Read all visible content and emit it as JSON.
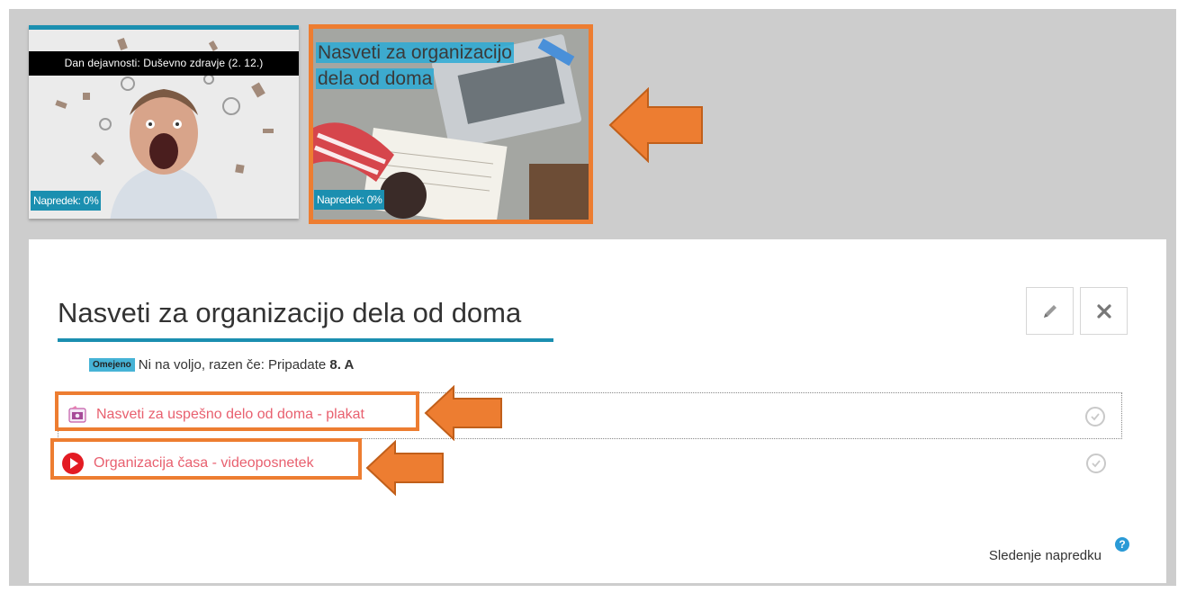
{
  "tiles": [
    {
      "title": "Dan dejavnosti: Duševno zdravje (2. 12.)",
      "progress": "Napredek: 0%",
      "image": "stressed-man-image"
    },
    {
      "title": "Nasveti za organizacijo dela od doma",
      "progress": "Napredek: 0%",
      "image": "laptop-desk-image",
      "highlighted": true
    }
  ],
  "section": {
    "title": "Nasveti za organizacijo dela od doma",
    "restriction": {
      "badge": "Omejeno",
      "text": "Ni na voljo, razen če: Pripadate",
      "group": "8. A"
    },
    "activities": [
      {
        "icon": "poster-image-icon",
        "label": "Nasveti za uspešno delo od doma - plakat"
      },
      {
        "icon": "video-play-icon",
        "label": "Organizacija časa - videoposnetek"
      }
    ],
    "progress_tracking": "Sledenje napredku",
    "help_icon": "?",
    "edit_icon": "pencil-icon",
    "close_icon": "close-icon"
  },
  "colors": {
    "accent": "#1b8fb0",
    "highlight": "#ed7d31",
    "link": "#e8606f",
    "background": "#cdcdcd"
  }
}
